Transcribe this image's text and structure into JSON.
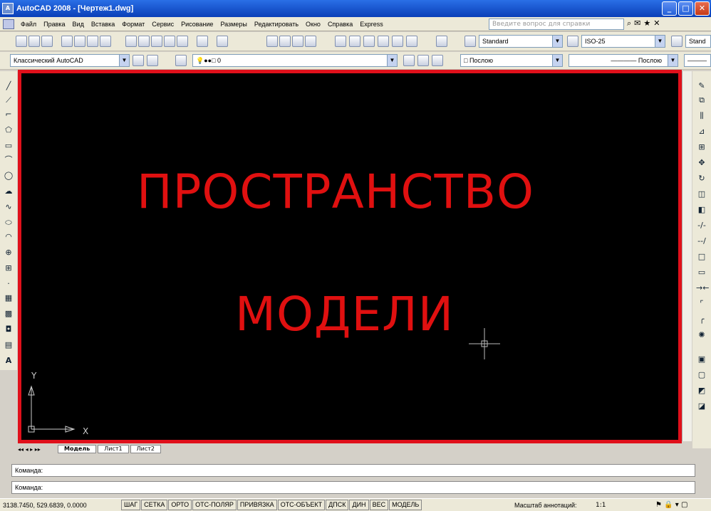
{
  "window": {
    "title": "AutoCAD 2008 - [Чертеж1.dwg]",
    "app_icon": "A"
  },
  "menu": [
    "Файл",
    "Правка",
    "Вид",
    "Вставка",
    "Формат",
    "Сервис",
    "Рисование",
    "Размеры",
    "Редактировать",
    "Окно",
    "Справка",
    "Express"
  ],
  "help_search": {
    "placeholder": "Введите вопрос для справки"
  },
  "toolbar1": {
    "text_style": "Standard",
    "dim_style": "ISO-25",
    "table_style": "Stand"
  },
  "toolbar2": {
    "workspace": "Классический AutoCAD",
    "layer": "0",
    "color": "Послою",
    "linetype": "Послою"
  },
  "canvas": {
    "line1": "ПРОСТРАНСТВО",
    "line2": "МОДЕЛИ",
    "ucs_y": "Y",
    "ucs_x": "X",
    "background": "#000000",
    "frame_color": "#e0101b"
  },
  "tabs": [
    "Модель",
    "Лист1",
    "Лист2"
  ],
  "command": {
    "line1": "Команда:",
    "line2": "Команда:"
  },
  "status": {
    "coords": "3138.7450, 529.6839, 0.0000",
    "buttons": [
      "ШАГ",
      "СЕТКА",
      "ОРТО",
      "ОТС-ПОЛЯР",
      "ПРИВЯЗКА",
      "ОТС-ОБЪЕКТ",
      "ДПСК",
      "ДИН",
      "ВЕС",
      "МОДЕЛЬ"
    ],
    "scale_label": "Масштаб аннотаций:",
    "scale_value": "1:1"
  }
}
